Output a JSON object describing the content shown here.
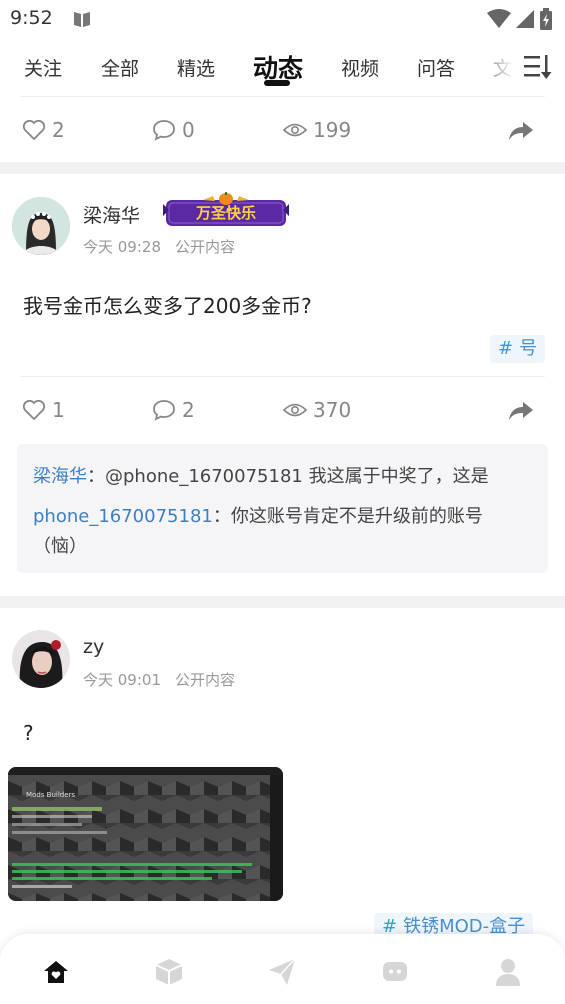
{
  "status_bar": {
    "time": "9:52"
  },
  "tabs": [
    {
      "label": "关注",
      "active": false
    },
    {
      "label": "全部",
      "active": false
    },
    {
      "label": "精选",
      "active": false
    },
    {
      "label": "动态",
      "active": true
    },
    {
      "label": "视频",
      "active": false
    },
    {
      "label": "问答",
      "active": false
    },
    {
      "label": "文",
      "active": false
    }
  ],
  "prev_post": {
    "likes": "2",
    "comments": "0",
    "views": "199"
  },
  "post1": {
    "username": "梁海华",
    "badge": "万圣快乐",
    "time": "今天 09:28",
    "visibility": "公开内容",
    "text": "我号金币怎么变多了200多金币?",
    "tag": "号",
    "likes": "1",
    "comments": "2",
    "views": "370",
    "comment_list": [
      {
        "user": "梁海华",
        "text": "：@phone_1670075181 我这属于中奖了，这是"
      },
      {
        "user": "phone_1670075181",
        "text": "：你这账号肯定不是升级前的账号",
        "text2": "（恼）"
      }
    ]
  },
  "post2": {
    "username": "zy",
    "time": "今天 09:01",
    "visibility": "公开内容",
    "text": "?",
    "tag": "铁锈MOD-盒子",
    "image_text": "Mods Builders"
  },
  "bottom_nav": [
    {
      "icon": "home-icon",
      "active": true
    },
    {
      "icon": "cube-icon",
      "active": false
    },
    {
      "icon": "paper-plane-icon",
      "active": false
    },
    {
      "icon": "chat-bubble-icon",
      "active": false
    },
    {
      "icon": "person-icon",
      "active": false
    }
  ],
  "colors": {
    "accent": "#3e7fc4",
    "tag_bg": "#eef5fb",
    "badge_bg": "#5b2aa3",
    "badge_text": "#ffd43a"
  }
}
